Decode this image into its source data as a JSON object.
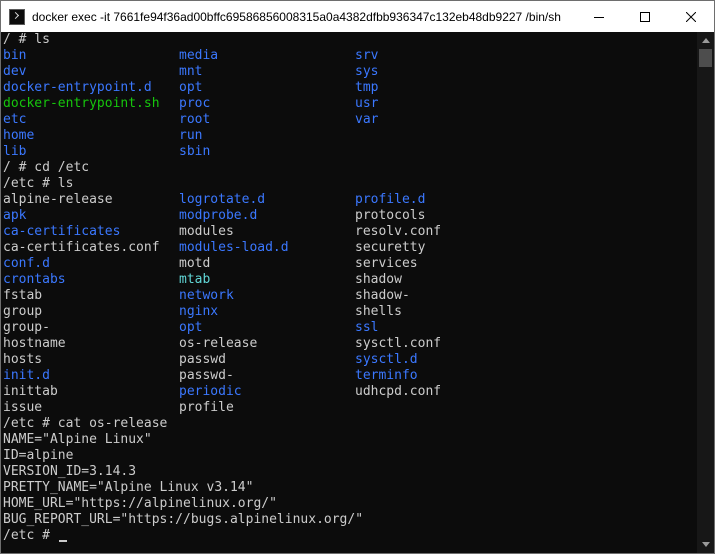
{
  "window": {
    "title": "docker  exec -it 7661fe94f36ad00bffc69586856008315a0a4382dfbb936347c132eb48db9227 /bin/sh",
    "icon": "console-icon",
    "controls": [
      "minimize-icon",
      "maximize-icon",
      "close-icon"
    ]
  },
  "colors": {
    "background": "#0c0c0c",
    "text": "#cccccc",
    "directory": "#3b78ff",
    "executable": "#16c60c",
    "symlink": "#61d6d6"
  },
  "terminal": {
    "lines": [
      {
        "text": "/ # ls"
      },
      {
        "cols": [
          {
            "t": "bin",
            "k": "dir"
          },
          {
            "t": "media",
            "k": "dir"
          },
          {
            "t": "srv",
            "k": "dir"
          }
        ]
      },
      {
        "cols": [
          {
            "t": "dev",
            "k": "dir"
          },
          {
            "t": "mnt",
            "k": "dir"
          },
          {
            "t": "sys",
            "k": "dir"
          }
        ]
      },
      {
        "cols": [
          {
            "t": "docker-entrypoint.d",
            "k": "dir"
          },
          {
            "t": "opt",
            "k": "dir"
          },
          {
            "t": "tmp",
            "k": "dir"
          }
        ]
      },
      {
        "cols": [
          {
            "t": "docker-entrypoint.sh",
            "k": "exe"
          },
          {
            "t": "proc",
            "k": "dir"
          },
          {
            "t": "usr",
            "k": "dir"
          }
        ]
      },
      {
        "cols": [
          {
            "t": "etc",
            "k": "dir"
          },
          {
            "t": "root",
            "k": "dir"
          },
          {
            "t": "var",
            "k": "dir"
          }
        ]
      },
      {
        "cols": [
          {
            "t": "home",
            "k": "dir"
          },
          {
            "t": "run",
            "k": "dir"
          },
          {
            "t": "",
            "k": ""
          }
        ]
      },
      {
        "cols": [
          {
            "t": "lib",
            "k": "dir"
          },
          {
            "t": "sbin",
            "k": "dir"
          },
          {
            "t": "",
            "k": ""
          }
        ]
      },
      {
        "text": "/ # cd /etc"
      },
      {
        "text": "/etc # ls"
      },
      {
        "cols": [
          {
            "t": "alpine-release",
            "k": ""
          },
          {
            "t": "logrotate.d",
            "k": "dir"
          },
          {
            "t": "profile.d",
            "k": "dir"
          }
        ]
      },
      {
        "cols": [
          {
            "t": "apk",
            "k": "dir"
          },
          {
            "t": "modprobe.d",
            "k": "dir"
          },
          {
            "t": "protocols",
            "k": ""
          }
        ]
      },
      {
        "cols": [
          {
            "t": "ca-certificates",
            "k": "dir"
          },
          {
            "t": "modules",
            "k": ""
          },
          {
            "t": "resolv.conf",
            "k": ""
          }
        ]
      },
      {
        "cols": [
          {
            "t": "ca-certificates.conf",
            "k": ""
          },
          {
            "t": "modules-load.d",
            "k": "dir"
          },
          {
            "t": "securetty",
            "k": ""
          }
        ]
      },
      {
        "cols": [
          {
            "t": "conf.d",
            "k": "dir"
          },
          {
            "t": "motd",
            "k": ""
          },
          {
            "t": "services",
            "k": ""
          }
        ]
      },
      {
        "cols": [
          {
            "t": "crontabs",
            "k": "dir"
          },
          {
            "t": "mtab",
            "k": "lnk"
          },
          {
            "t": "shadow",
            "k": ""
          }
        ]
      },
      {
        "cols": [
          {
            "t": "fstab",
            "k": ""
          },
          {
            "t": "network",
            "k": "dir"
          },
          {
            "t": "shadow-",
            "k": ""
          }
        ]
      },
      {
        "cols": [
          {
            "t": "group",
            "k": ""
          },
          {
            "t": "nginx",
            "k": "dir"
          },
          {
            "t": "shells",
            "k": ""
          }
        ]
      },
      {
        "cols": [
          {
            "t": "group-",
            "k": ""
          },
          {
            "t": "opt",
            "k": "dir"
          },
          {
            "t": "ssl",
            "k": "dir"
          }
        ]
      },
      {
        "cols": [
          {
            "t": "hostname",
            "k": ""
          },
          {
            "t": "os-release",
            "k": ""
          },
          {
            "t": "sysctl.conf",
            "k": ""
          }
        ]
      },
      {
        "cols": [
          {
            "t": "hosts",
            "k": ""
          },
          {
            "t": "passwd",
            "k": ""
          },
          {
            "t": "sysctl.d",
            "k": "dir"
          }
        ]
      },
      {
        "cols": [
          {
            "t": "init.d",
            "k": "dir"
          },
          {
            "t": "passwd-",
            "k": ""
          },
          {
            "t": "terminfo",
            "k": "dir"
          }
        ]
      },
      {
        "cols": [
          {
            "t": "inittab",
            "k": ""
          },
          {
            "t": "periodic",
            "k": "dir"
          },
          {
            "t": "udhcpd.conf",
            "k": ""
          }
        ]
      },
      {
        "cols": [
          {
            "t": "issue",
            "k": ""
          },
          {
            "t": "profile",
            "k": ""
          },
          {
            "t": "",
            "k": ""
          }
        ]
      },
      {
        "text": "/etc # cat os-release"
      },
      {
        "text": "NAME=\"Alpine Linux\""
      },
      {
        "text": "ID=alpine"
      },
      {
        "text": "VERSION_ID=3.14.3"
      },
      {
        "text": "PRETTY_NAME=\"Alpine Linux v3.14\""
      },
      {
        "text": "HOME_URL=\"https://alpinelinux.org/\""
      },
      {
        "text": "BUG_REPORT_URL=\"https://bugs.alpinelinux.org/\""
      },
      {
        "text": "/etc # ",
        "cursor": true
      }
    ]
  }
}
